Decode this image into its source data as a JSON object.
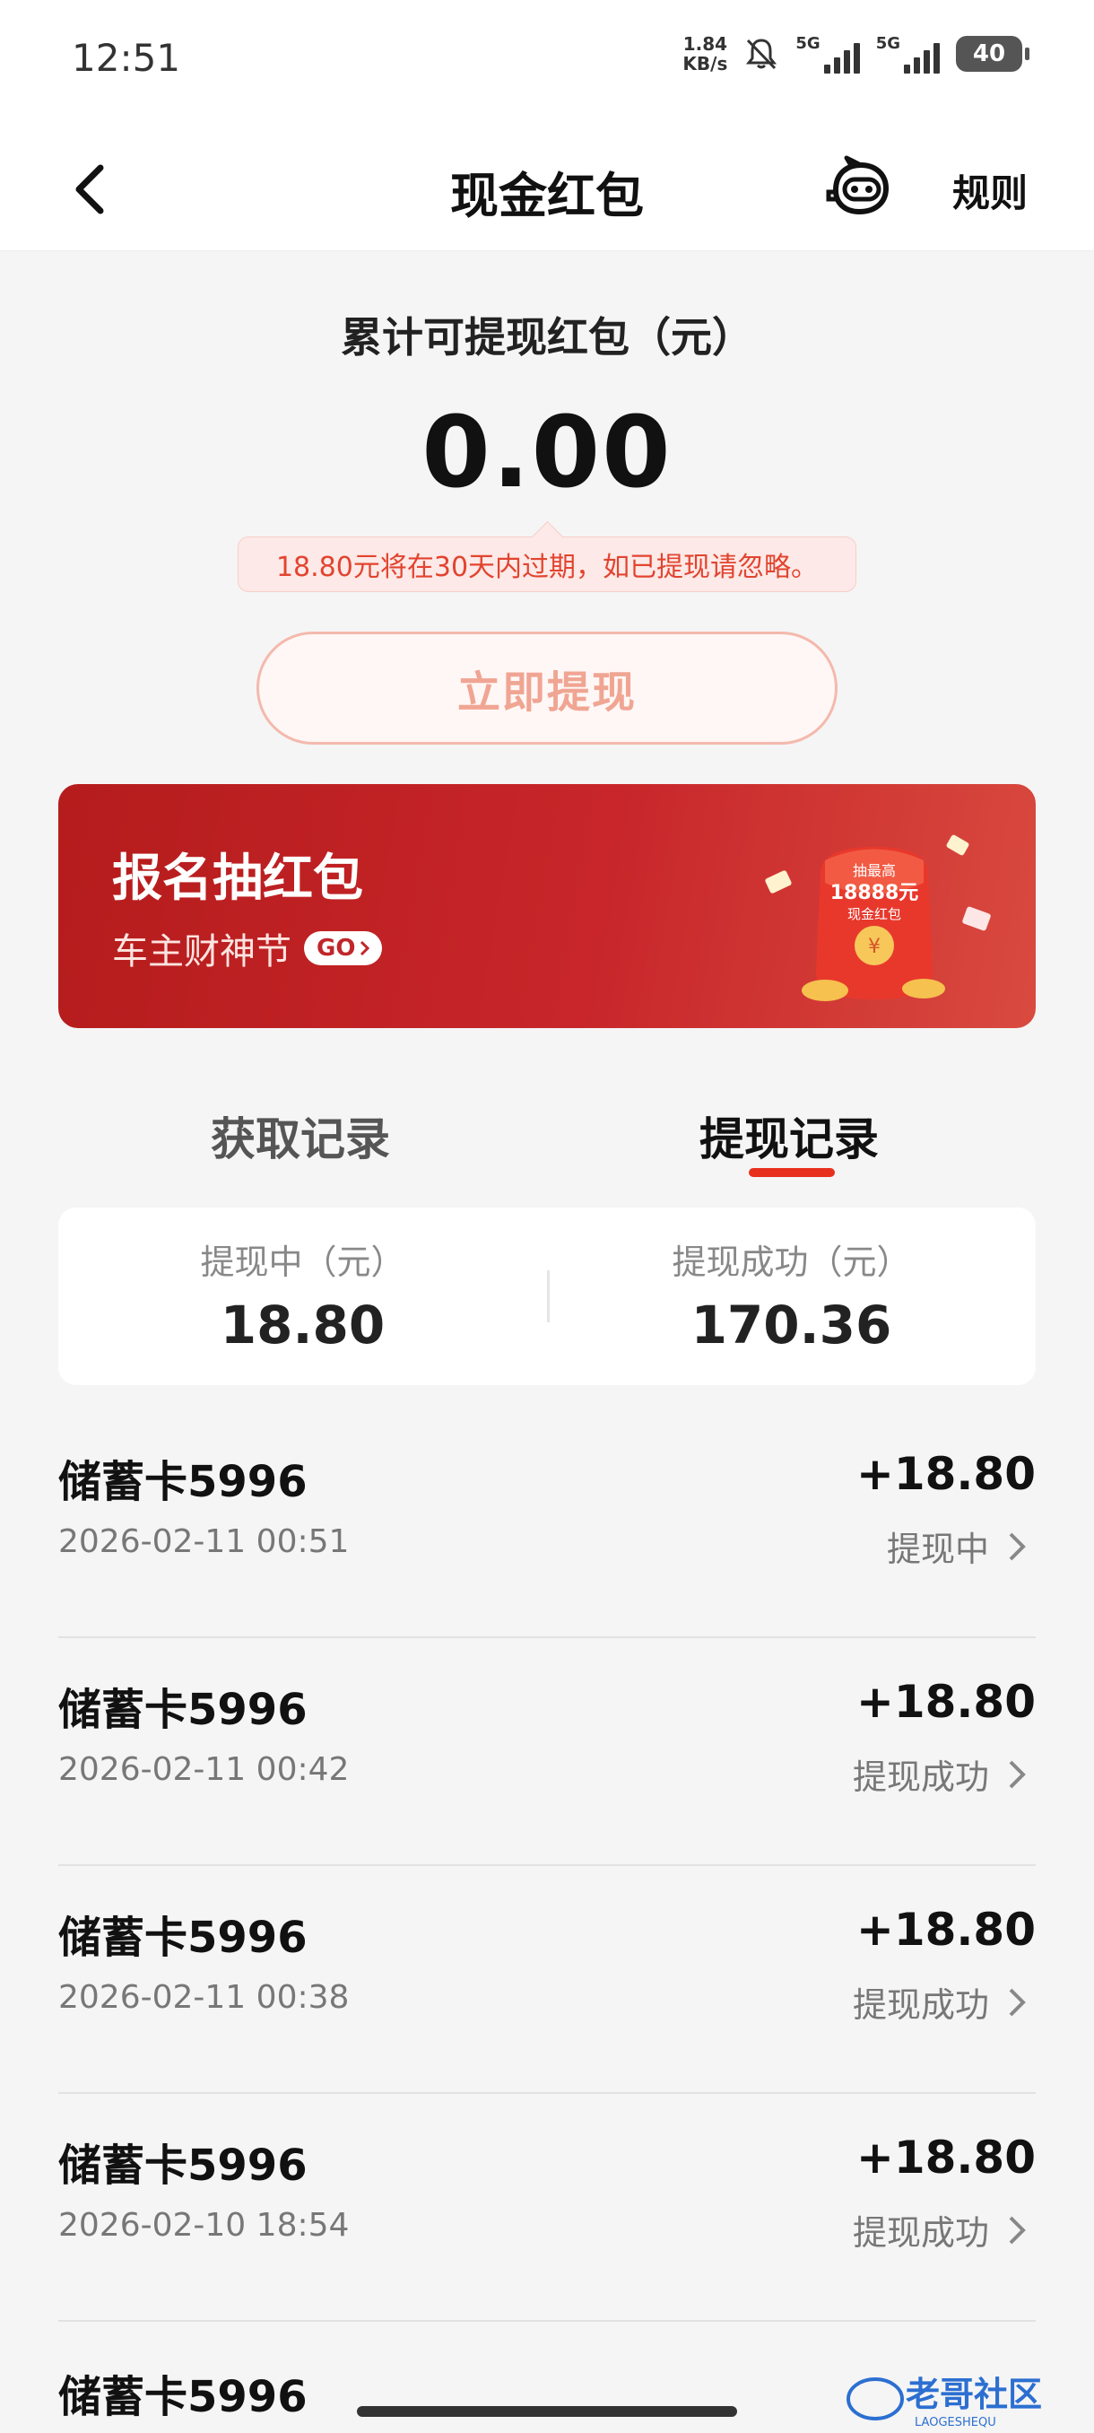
{
  "status_bar": {
    "time": "12:51",
    "speed_value": "1.84",
    "speed_unit": "KB/s",
    "sim1_label": "5G",
    "sim2_label": "5G",
    "battery": "40"
  },
  "nav": {
    "title": "现金红包",
    "rules": "规则"
  },
  "balance": {
    "label": "累计可提现红包（元）",
    "amount": "0.00",
    "notice": "18.80元将在30天内过期，如已提现请忽略。",
    "withdraw_button": "立即提现"
  },
  "promo": {
    "title": "报名抽红包",
    "subtitle": "车主财神节",
    "go_label": "GO",
    "art_line1": "抽最高",
    "art_line2": "18888元",
    "art_line3": "现金红包"
  },
  "tabs": {
    "get_records": "获取记录",
    "withdraw_records": "提现记录"
  },
  "summary": {
    "pending_label": "提现中（元）",
    "pending_value": "18.80",
    "success_label": "提现成功（元）",
    "success_value": "170.36"
  },
  "records": [
    {
      "title": "储蓄卡5996",
      "date": "2026-02-11 00:51",
      "amount": "+18.80",
      "status": "提现中"
    },
    {
      "title": "储蓄卡5996",
      "date": "2026-02-11 00:42",
      "amount": "+18.80",
      "status": "提现成功"
    },
    {
      "title": "储蓄卡5996",
      "date": "2026-02-11 00:38",
      "amount": "+18.80",
      "status": "提现成功"
    },
    {
      "title": "储蓄卡5996",
      "date": "2026-02-10 18:54",
      "amount": "+18.80",
      "status": "提现成功"
    },
    {
      "title": "储蓄卡5996"
    }
  ],
  "watermark": {
    "text": "老哥社区",
    "sub": "LAOGESHEQU"
  }
}
